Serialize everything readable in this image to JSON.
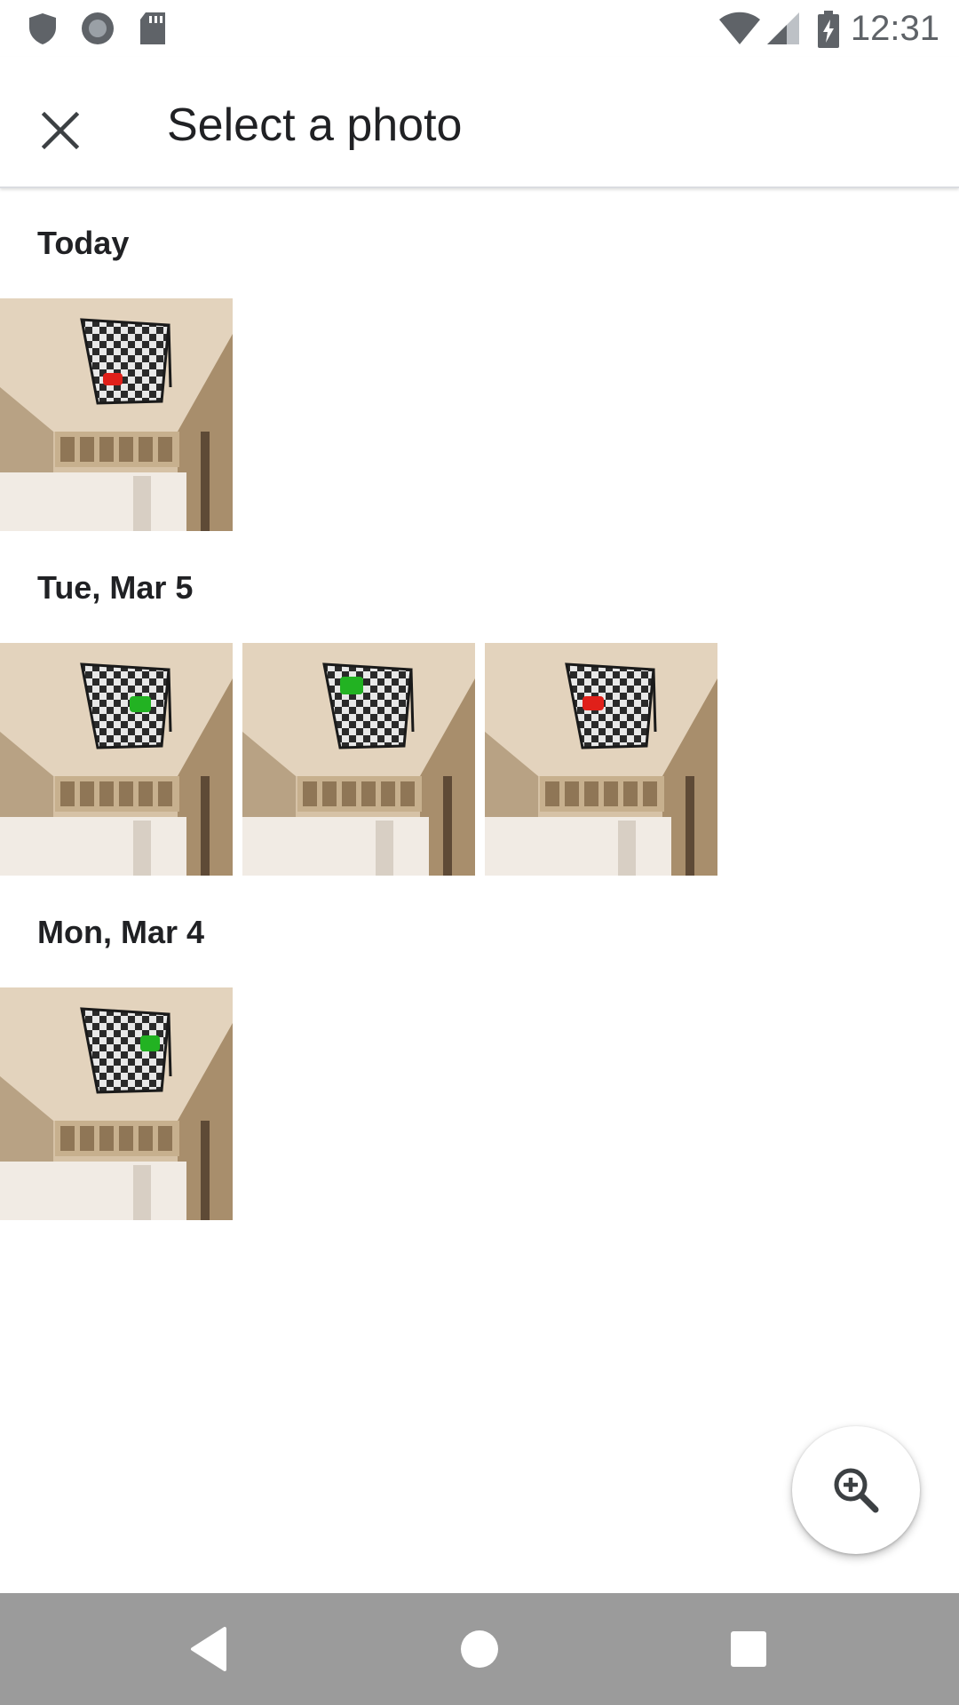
{
  "status_bar": {
    "time": "12:31",
    "left_icons": [
      "shield-icon",
      "circle-record-icon",
      "sd-card-icon"
    ],
    "right_icons": [
      "wifi-icon",
      "cellular-signal-icon",
      "battery-charging-icon"
    ]
  },
  "app_bar": {
    "title": "Select a photo",
    "close_icon": "close-icon"
  },
  "sections": [
    {
      "title": "Today",
      "photos": [
        {
          "marker_color": "#e0201a"
        }
      ]
    },
    {
      "title": "Tue, Mar 5",
      "photos": [
        {
          "marker_color": "#22b222"
        },
        {
          "marker_color": "#22b222"
        },
        {
          "marker_color": "#e0201a"
        }
      ]
    },
    {
      "title": "Mon, Mar 4",
      "photos": [
        {
          "marker_color": "#22b222"
        }
      ]
    }
  ],
  "fab": {
    "icon": "zoom-in-icon"
  },
  "nav_bar": {
    "icons": [
      "back-icon",
      "home-icon",
      "recents-icon"
    ]
  },
  "colors": {
    "nav_bar": "#9b9b9b",
    "text": "#202124",
    "divider": "#dadce0"
  }
}
